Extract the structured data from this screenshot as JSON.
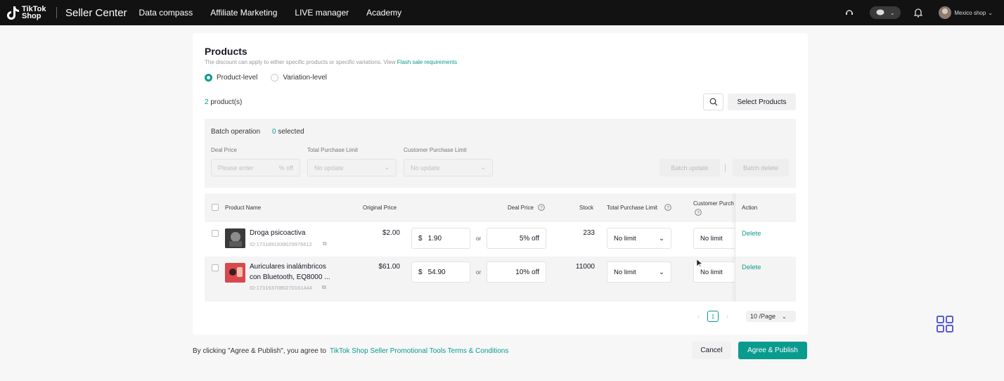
{
  "topbar": {
    "logo_text": "TikTok Shop",
    "app_title": "Seller Center",
    "nav": [
      "Data compass",
      "Affiliate Marketing",
      "LIVE manager",
      "Academy"
    ],
    "shop_name": "Mexico shop"
  },
  "products": {
    "title": "Products",
    "hint": "The discount can apply to either specific products or specific variations. View",
    "hint_link": "Flash sale requirements",
    "radio_product": "Product-level",
    "radio_variation": "Variation-level",
    "count_num": "2",
    "count_suffix": " product(s)",
    "select_products": "Select Products"
  },
  "batch": {
    "title": "Batch operation",
    "selected_num": "0",
    "selected_suffix": " selected",
    "deal_price_label": "Deal Price",
    "deal_price_placeholder": "Please enter",
    "deal_price_unit": "% off",
    "total_limit_label": "Total Purchase Limit",
    "total_limit_value": "No update",
    "customer_limit_label": "Customer Purchase Limit",
    "customer_limit_value": "No update",
    "update_button": "Batch update",
    "delete_button": "Batch delete"
  },
  "table": {
    "headers": {
      "product_name": "Product Name",
      "original_price": "Original Price",
      "deal_price": "Deal Price",
      "stock": "Stock",
      "total_limit": "Total Purchase Limit",
      "customer_limit": "Customer Purch",
      "action": "Action"
    },
    "or_label": "or",
    "currency": "$",
    "rows": [
      {
        "name": "Droga psicoactiva",
        "id": "ID:1731891939029976612",
        "original_price": "$2.00",
        "deal_price": "1.90",
        "discount": "5% off",
        "stock": "233",
        "total_limit": "No limit",
        "customer_limit": "No limit",
        "action": "Delete"
      },
      {
        "name": "Auriculares inalámbricos con Bluetooth, EQ8000 ...",
        "id": "ID:1731937080270161444",
        "original_price": "$61.00",
        "deal_price": "54.90",
        "discount": "10% off",
        "stock": "11000",
        "total_limit": "No limit",
        "customer_limit": "No limit",
        "action": "Delete"
      }
    ]
  },
  "pagination": {
    "current_page": "1",
    "per_page": "10 /Page"
  },
  "footer": {
    "text": "By clicking \"Agree & Publish\", you agree to",
    "link": "TikTok Shop Seller Promotional Tools Terms & Conditions",
    "cancel": "Cancel",
    "publish": "Agree & Publish"
  },
  "colors": {
    "accent": "#0a9b8f",
    "topbar": "#121212"
  }
}
